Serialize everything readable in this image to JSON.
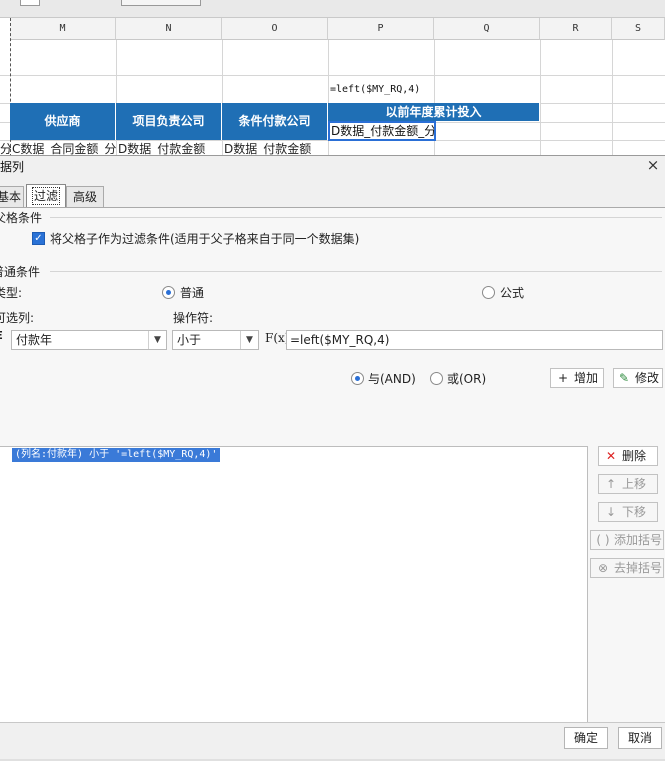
{
  "sheet": {
    "columns": [
      "M",
      "N",
      "O",
      "P",
      "Q",
      "R",
      "S"
    ],
    "formula_cell": "=left($MY_RQ,4)",
    "headers": {
      "supplier": "供应商",
      "project_company": "项目负责公司",
      "condition_payment": "条件付款公司",
      "prior_years": "以前年度累计投入"
    },
    "row3": {
      "left_fragment": "分",
      "m": "C数据_合同金额_分",
      "n": "D数据_付款金额",
      "o": "D数据_付款金额"
    },
    "selected_cell": "D数据_付款金额_分"
  },
  "dialog": {
    "title": "据列",
    "close_icon": "×",
    "tabs": [
      "基本",
      "过滤",
      "高级"
    ],
    "active_tab": "过滤",
    "parent_section": {
      "title": "父格条件",
      "checkbox_label": "将父格子作为过滤条件(适用于父子格来自于同一个数据集)",
      "checked": true
    },
    "general_section": {
      "title": "普通条件",
      "type_label": "类型:",
      "type_options": [
        "普通",
        "公式"
      ],
      "type_selected": "普通",
      "column_label": "可选列:",
      "column_value": "付款年",
      "operator_label": "操作符:",
      "operator_value": "小于",
      "fx_label": "F(x)",
      "value": "=left($MY_RQ,4)"
    },
    "logic": {
      "and_label": "与(AND)",
      "or_label": "或(OR)",
      "selected": "and"
    },
    "add_button": "增加",
    "modify_button": "修改",
    "conditions": [
      "(列名:付款年) 小于 '=left($MY_RQ,4)'"
    ],
    "side_buttons": {
      "delete": "删除",
      "up": "上移",
      "down": "下移",
      "add_bracket": "添加括号",
      "remove_bracket": "去掉括号"
    },
    "ok_button": "确定",
    "cancel_button": "取消"
  }
}
